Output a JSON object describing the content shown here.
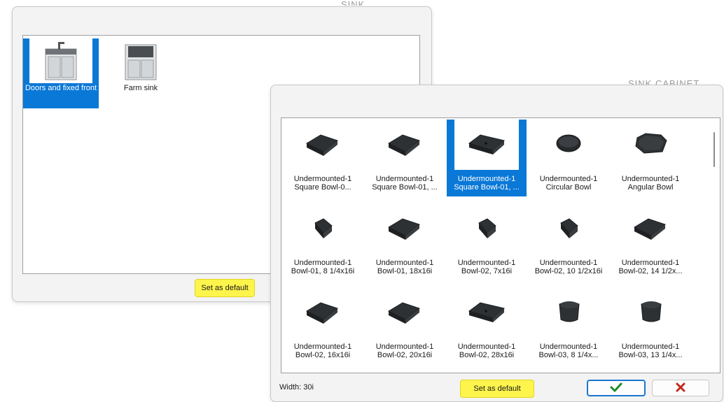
{
  "window1": {
    "items": [
      {
        "label": "Doors and fixed front",
        "selected": true,
        "icon": "sink-cabinet-icon"
      },
      {
        "label": "Farm sink",
        "selected": false,
        "icon": "farm-sink-cabinet-icon"
      }
    ],
    "set_default_label": "Set as default"
  },
  "window2": {
    "items": [
      {
        "label": "Undermounted-1 Square Bowl-0...",
        "selected": false,
        "shape": "square"
      },
      {
        "label": "Undermounted-1 Square Bowl-01, ...",
        "selected": false,
        "shape": "square"
      },
      {
        "label": "Undermounted-1 Square Bowl-01, ...",
        "selected": true,
        "shape": "wide"
      },
      {
        "label": "Undermounted-1 Circular Bowl",
        "selected": false,
        "shape": "round"
      },
      {
        "label": "Undermounted-1 Angular Bowl",
        "selected": false,
        "shape": "angular"
      },
      {
        "label": "Undermounted-1 Bowl-01, 8 1/4x16i",
        "selected": false,
        "shape": "narrow"
      },
      {
        "label": "Undermounted-1 Bowl-01, 18x16i",
        "selected": false,
        "shape": "square"
      },
      {
        "label": "Undermounted-1 Bowl-02, 7x16i",
        "selected": false,
        "shape": "narrow"
      },
      {
        "label": "Undermounted-1 Bowl-02, 10 1/2x16i",
        "selected": false,
        "shape": "narrow"
      },
      {
        "label": "Undermounted-1 Bowl-02, 14 1/2x...",
        "selected": false,
        "shape": "square"
      },
      {
        "label": "Undermounted-1 Bowl-02, 16x16i",
        "selected": false,
        "shape": "square"
      },
      {
        "label": "Undermounted-1 Bowl-02, 20x16i",
        "selected": false,
        "shape": "square"
      },
      {
        "label": "Undermounted-1 Bowl-02, 28x16i",
        "selected": false,
        "shape": "wide"
      },
      {
        "label": "Undermounted-1 Bowl-03, 8 1/4x...",
        "selected": false,
        "shape": "tub"
      },
      {
        "label": "Undermounted-1 Bowl-03, 13 1/4x...",
        "selected": false,
        "shape": "tub"
      }
    ],
    "status_text": "Width: 30i",
    "set_default_label": "Set as default",
    "ok_icon": "checkmark-icon",
    "cancel_icon": "close-x-icon"
  },
  "colors": {
    "selection": "#0a78d7",
    "highlight": "#fdf44c",
    "ok": "#1f8a2e",
    "cancel": "#c0281e"
  }
}
